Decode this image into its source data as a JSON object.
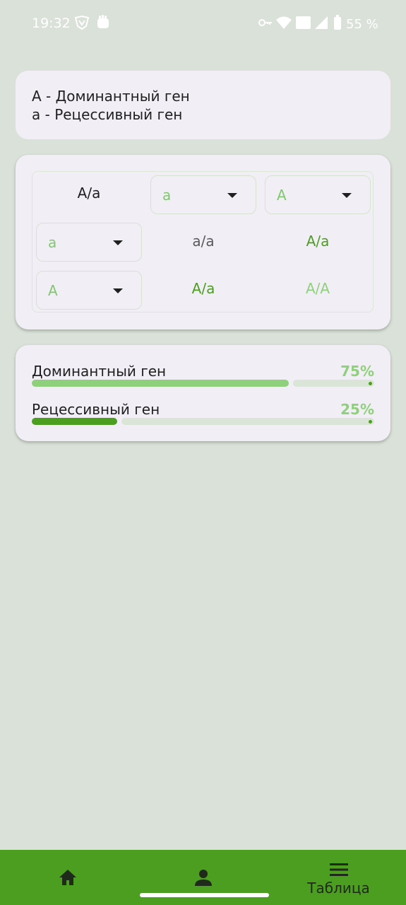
{
  "status_bar": {
    "time": "19:32",
    "battery": "55 %"
  },
  "legend": {
    "dominant": "A - Доминантный ген",
    "recessive": "a - Рецессивный ген"
  },
  "punnett": {
    "corner": "A/a",
    "col_selects": [
      "a",
      "A"
    ],
    "row_selects": [
      "a",
      "A"
    ],
    "results": [
      [
        "a/a",
        "A/a"
      ],
      [
        "A/a",
        "A/A"
      ]
    ]
  },
  "stats": {
    "dominant": {
      "label": "Доминантный ген",
      "percent": "75%",
      "value": 0.75,
      "color": "#8fd07c"
    },
    "recessive": {
      "label": "Рецессивный ген",
      "percent": "25%",
      "value": 0.25,
      "color": "#4b9e20"
    }
  },
  "nav": {
    "table_label": "Таблица",
    "icons": [
      "home-icon",
      "person-icon",
      "menu-icon"
    ]
  },
  "colors": {
    "background": "#d9e1d8",
    "card": "#f2eef5",
    "accent_dark": "#4b9e20",
    "accent_light": "#8fd07c"
  }
}
